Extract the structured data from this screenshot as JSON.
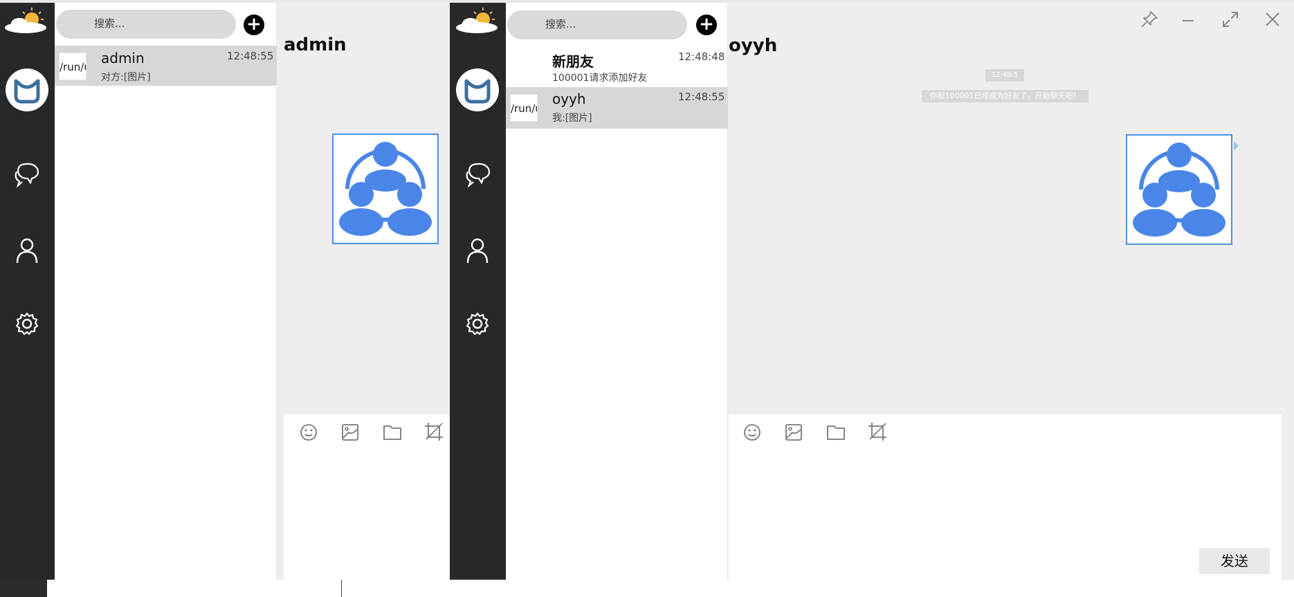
{
  "left_window": {
    "search_placeholder": "搜索...",
    "add_label": "+",
    "contacts": [
      {
        "avatar_text": "/run/user",
        "name": "admin",
        "time": "12:48:55",
        "preview": "对方:[图片]"
      }
    ],
    "chat_title": "admin"
  },
  "right_window": {
    "search_placeholder": "搜索...",
    "add_label": "+",
    "contacts": [
      {
        "name": "新朋友",
        "time": "12:48:48",
        "preview": "100001请求添加好友"
      },
      {
        "avatar_text": "/run/user",
        "name": "oyyh",
        "time": "12:48:55",
        "preview": "我:[图片]"
      }
    ],
    "chat_title": "oyyh",
    "system_time": "12:48:5",
    "system_message": "你和100001已经成为好友了，开始聊天吧！",
    "send_label": "发送"
  },
  "icons": {
    "logo": "weather-logo-icon",
    "chat": "chat-bubbles-icon",
    "contacts": "person-icon",
    "settings": "gear-icon",
    "emoji": "smiley-icon",
    "image": "image-icon",
    "file": "folder-icon",
    "crop": "crop-icon",
    "pin": "pin-icon",
    "minimize": "minimize-icon",
    "maximize": "maximize-icon",
    "close": "close-icon"
  },
  "colors": {
    "sidebar": "#27282c",
    "selected_row": "#d9d7d5",
    "chat_bg": "#eeeeee",
    "image_border": "#4a93e2",
    "group_icon": "#4a86e8"
  }
}
